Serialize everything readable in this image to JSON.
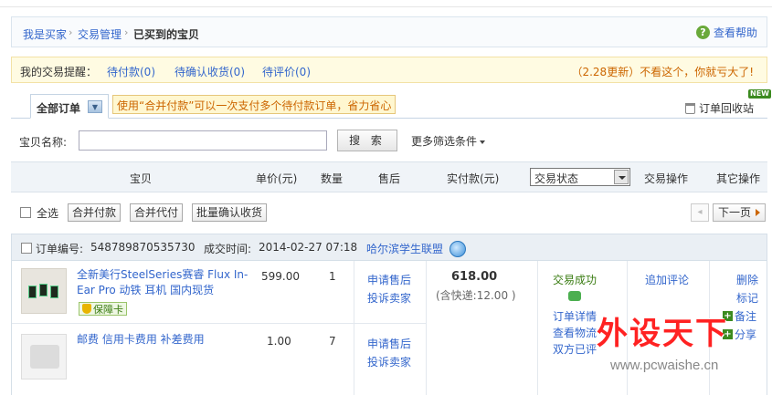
{
  "breadcrumb": {
    "items": [
      "我是买家",
      "交易管理"
    ],
    "separator": "›",
    "current": "已买到的宝贝",
    "help": "查看帮助"
  },
  "reminder": {
    "title": "我的交易提醒：",
    "links": [
      "待付款(0)",
      "待确认收货(0)",
      "待评价(0)"
    ],
    "notice": "（2.28更新）不看这个，你就亏大了!"
  },
  "tabs": {
    "all": "全部订单",
    "tip": "使用“合并付款”可以一次支付多个待付款订单，省力省心",
    "recycle": "订单回收站",
    "new_badge": "NEW"
  },
  "search": {
    "label": "宝贝名称:",
    "value": "",
    "button": "搜 索",
    "more": "更多筛选条件"
  },
  "table_header": {
    "columns": [
      "宝贝",
      "单价(元)",
      "数量",
      "售后",
      "实付款(元)",
      "交易操作",
      "其它操作"
    ],
    "status_select": "交易状态"
  },
  "toolbar": {
    "select_all": "全选",
    "buttons": [
      "合并付款",
      "合并代付",
      "批量确认收货"
    ],
    "prev": "◂",
    "next": "下一页"
  },
  "order": {
    "number_label": "订单编号:",
    "number": "548789870535730",
    "time_label": "成交时间:",
    "time": "2014-02-27 07:18",
    "shop": "哈尔滨学生联盟",
    "items": [
      {
        "title": "全新美行SteelSeries赛睿 Flux In-Ear Pro 动铁 耳机 国内现货",
        "badge": "保障卡",
        "price": "599.00",
        "qty": "1",
        "after_sale": [
          "申请售后",
          "投诉卖家"
        ]
      },
      {
        "title": "邮费 信用卡费用 补差费用",
        "price": "1.00",
        "qty": "7",
        "after_sale": [
          "申请售后",
          "投诉卖家"
        ]
      }
    ],
    "total": "618.00",
    "shipping": "(含快递:12.00 )",
    "status": "交易成功",
    "status_links": [
      "订单详情",
      "查看物流",
      "双方已评"
    ],
    "comment": "追加评论",
    "other_ops": [
      "删除",
      "标记",
      "备注",
      "分享"
    ]
  },
  "watermark": {
    "text": "外设天下",
    "url": "www.pcwaishe.cn"
  },
  "colors": {
    "link": "#3366cc",
    "notice": "#cc6600",
    "success": "#3a7c12",
    "watermark": "#ff2222"
  }
}
